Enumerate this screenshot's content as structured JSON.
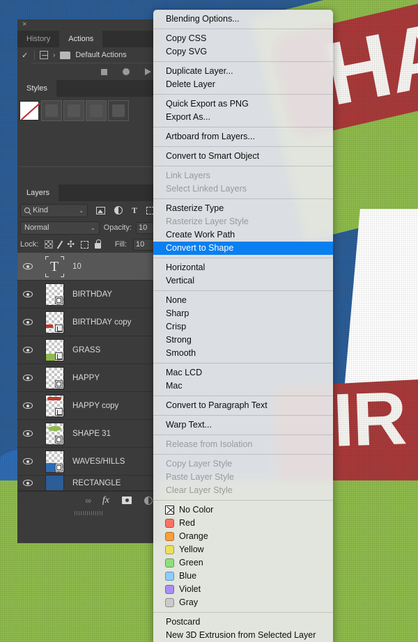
{
  "artwork": {
    "word_top": "HA",
    "word_bottom": "IR",
    "colors": {
      "sky": "#2b5d96",
      "grass": "#8fbb4d",
      "water": "#2d6cb5",
      "red": "#a83a3a",
      "white": "#ffffff"
    }
  },
  "panels": {
    "close_label": "×",
    "top_tabs": [
      {
        "label": "History",
        "active": false
      },
      {
        "label": "Actions",
        "active": true
      }
    ],
    "actions": {
      "check": "✓",
      "chevron": "›",
      "set_name": "Default Actions"
    },
    "styles_tab": "Styles",
    "layers_tab": "Layers",
    "layers": {
      "filter": {
        "kind_label": "Kind",
        "caret": "⌄"
      },
      "blend_mode": "Normal",
      "opacity_label": "Opacity:",
      "opacity_value": "10",
      "lock_label": "Lock:",
      "fill_label": "Fill:",
      "fill_value": "10",
      "rows": [
        {
          "name": "10",
          "selected": true,
          "kind": "text",
          "badge": "none"
        },
        {
          "name": "BIRTHDAY",
          "selected": false,
          "kind": "raster",
          "badge": "shape",
          "color": ""
        },
        {
          "name": "BIRTHDAY copy",
          "selected": false,
          "kind": "raster",
          "badge": "smart",
          "color": "#c0392b"
        },
        {
          "name": "GRASS",
          "selected": false,
          "kind": "raster",
          "badge": "smart",
          "color": "#8fbb4d"
        },
        {
          "name": "HAPPY",
          "selected": false,
          "kind": "raster",
          "badge": "shape",
          "color": ""
        },
        {
          "name": "HAPPY copy",
          "selected": false,
          "kind": "raster",
          "badge": "smart",
          "color": "#c0392b"
        },
        {
          "name": "SHAPE 31",
          "selected": false,
          "kind": "raster",
          "badge": "shape",
          "color": "#8fbb4d"
        },
        {
          "name": "WAVES/HILLS",
          "selected": false,
          "kind": "raster",
          "badge": "shape",
          "color": "#2d6cb5"
        },
        {
          "name": "RECTANGLE",
          "selected": false,
          "kind": "raster",
          "badge": "none",
          "color": "#2b5d96"
        }
      ]
    }
  },
  "context_menu": {
    "items": [
      {
        "label": "Blending Options...",
        "state": "normal"
      },
      {
        "type": "separator"
      },
      {
        "label": "Copy CSS",
        "state": "normal"
      },
      {
        "label": "Copy SVG",
        "state": "normal"
      },
      {
        "type": "separator"
      },
      {
        "label": "Duplicate Layer...",
        "state": "normal"
      },
      {
        "label": "Delete Layer",
        "state": "normal"
      },
      {
        "type": "separator"
      },
      {
        "label": "Quick Export as PNG",
        "state": "normal"
      },
      {
        "label": "Export As...",
        "state": "normal"
      },
      {
        "type": "separator"
      },
      {
        "label": "Artboard from Layers...",
        "state": "normal"
      },
      {
        "type": "separator"
      },
      {
        "label": "Convert to Smart Object",
        "state": "normal"
      },
      {
        "type": "separator"
      },
      {
        "label": "Link Layers",
        "state": "disabled"
      },
      {
        "label": "Select Linked Layers",
        "state": "disabled"
      },
      {
        "type": "separator"
      },
      {
        "label": "Rasterize Type",
        "state": "normal"
      },
      {
        "label": "Rasterize Layer Style",
        "state": "disabled"
      },
      {
        "label": "Create Work Path",
        "state": "normal"
      },
      {
        "label": "Convert to Shape",
        "state": "highlight"
      },
      {
        "type": "separator"
      },
      {
        "label": "Horizontal",
        "state": "normal"
      },
      {
        "label": "Vertical",
        "state": "normal"
      },
      {
        "type": "separator"
      },
      {
        "label": "None",
        "state": "normal"
      },
      {
        "label": "Sharp",
        "state": "normal"
      },
      {
        "label": "Crisp",
        "state": "normal"
      },
      {
        "label": "Strong",
        "state": "normal"
      },
      {
        "label": "Smooth",
        "state": "normal"
      },
      {
        "type": "separator"
      },
      {
        "label": "Mac LCD",
        "state": "normal"
      },
      {
        "label": "Mac",
        "state": "normal"
      },
      {
        "type": "separator"
      },
      {
        "label": "Convert to Paragraph Text",
        "state": "normal"
      },
      {
        "type": "separator"
      },
      {
        "label": "Warp Text...",
        "state": "normal"
      },
      {
        "type": "separator"
      },
      {
        "label": "Release from Isolation",
        "state": "disabled"
      },
      {
        "type": "separator"
      },
      {
        "label": "Copy Layer Style",
        "state": "disabled"
      },
      {
        "label": "Paste Layer Style",
        "state": "disabled"
      },
      {
        "label": "Clear Layer Style",
        "state": "disabled"
      },
      {
        "type": "separator"
      },
      {
        "label": "No Color",
        "state": "normal",
        "swatch": "none"
      },
      {
        "label": "Red",
        "state": "normal",
        "swatch": "#fb7265"
      },
      {
        "label": "Orange",
        "state": "normal",
        "swatch": "#f9a03c"
      },
      {
        "label": "Yellow",
        "state": "normal",
        "swatch": "#ecdf5c"
      },
      {
        "label": "Green",
        "state": "normal",
        "swatch": "#91dd7e"
      },
      {
        "label": "Blue",
        "state": "normal",
        "swatch": "#8ecdfb"
      },
      {
        "label": "Violet",
        "state": "normal",
        "swatch": "#a98ef5"
      },
      {
        "label": "Gray",
        "state": "normal",
        "swatch": "#cacaca"
      },
      {
        "type": "separator"
      },
      {
        "label": "Postcard",
        "state": "normal"
      },
      {
        "label": "New 3D Extrusion from Selected Layer",
        "state": "normal"
      }
    ]
  }
}
